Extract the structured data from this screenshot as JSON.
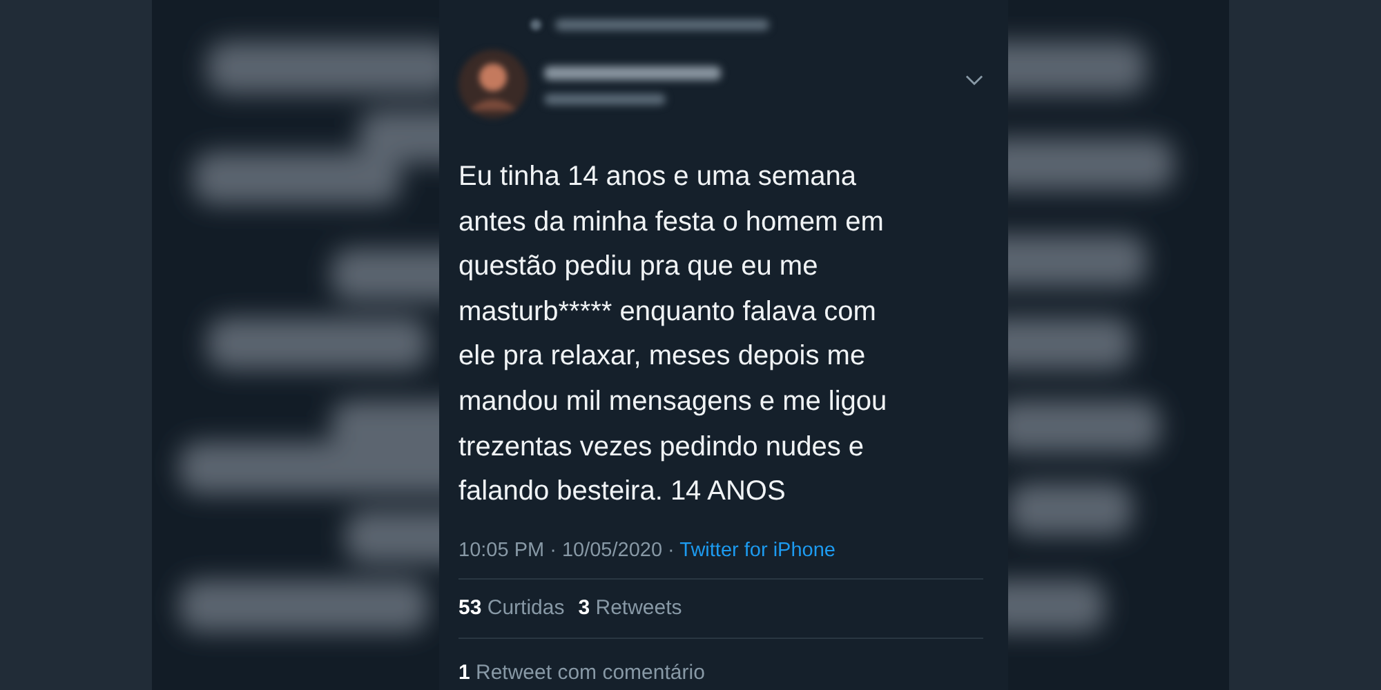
{
  "tweet": {
    "text": "Eu tinha 14 anos e uma semana\nantes da minha festa o homem em\nquestão pediu pra que eu me\nmasturb***** enquanto falava com\nele pra relaxar, meses depois me\nmandou mil mensagens e me ligou\ntrezentas vezes pedindo nudes e\nfalando besteira. 14 ANOS",
    "time": "10:05 PM · 10/05/2020 · ",
    "source": "Twitter for iPhone",
    "likes_count": "53",
    "likes_label": "Curtidas",
    "retweets_count": "3",
    "retweets_label": "Retweets",
    "quote_count": "1",
    "quote_label": "Retweet com comentário"
  }
}
